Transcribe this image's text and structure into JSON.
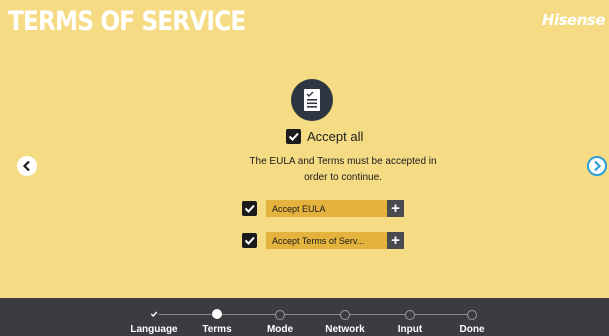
{
  "header": {
    "title": "TERMS OF SERVICE",
    "brand": "Hisense"
  },
  "main": {
    "icon": "document-check-icon",
    "accept_all_label": "Accept all",
    "accept_all_checked": true,
    "notice_line1": "The EULA and Terms must be accepted in",
    "notice_line2": "order to continue.",
    "items": [
      {
        "label": "Accept EULA",
        "checked": true,
        "action": "+"
      },
      {
        "label": "Accept Terms of Serv...",
        "checked": true,
        "action": "+"
      }
    ]
  },
  "nav": {
    "prev_icon": "chevron-left-icon",
    "next_icon": "chevron-right-icon"
  },
  "footer": {
    "steps": [
      {
        "label": "Language",
        "state": "done"
      },
      {
        "label": "Terms",
        "state": "current"
      },
      {
        "label": "Mode",
        "state": "pending"
      },
      {
        "label": "Network",
        "state": "pending"
      },
      {
        "label": "Input",
        "state": "pending"
      },
      {
        "label": "Done",
        "state": "pending"
      }
    ]
  },
  "colors": {
    "background": "#f5db84",
    "field": "#e3b33e",
    "footer": "#3b3c40",
    "accent": "#2d9fd6"
  }
}
